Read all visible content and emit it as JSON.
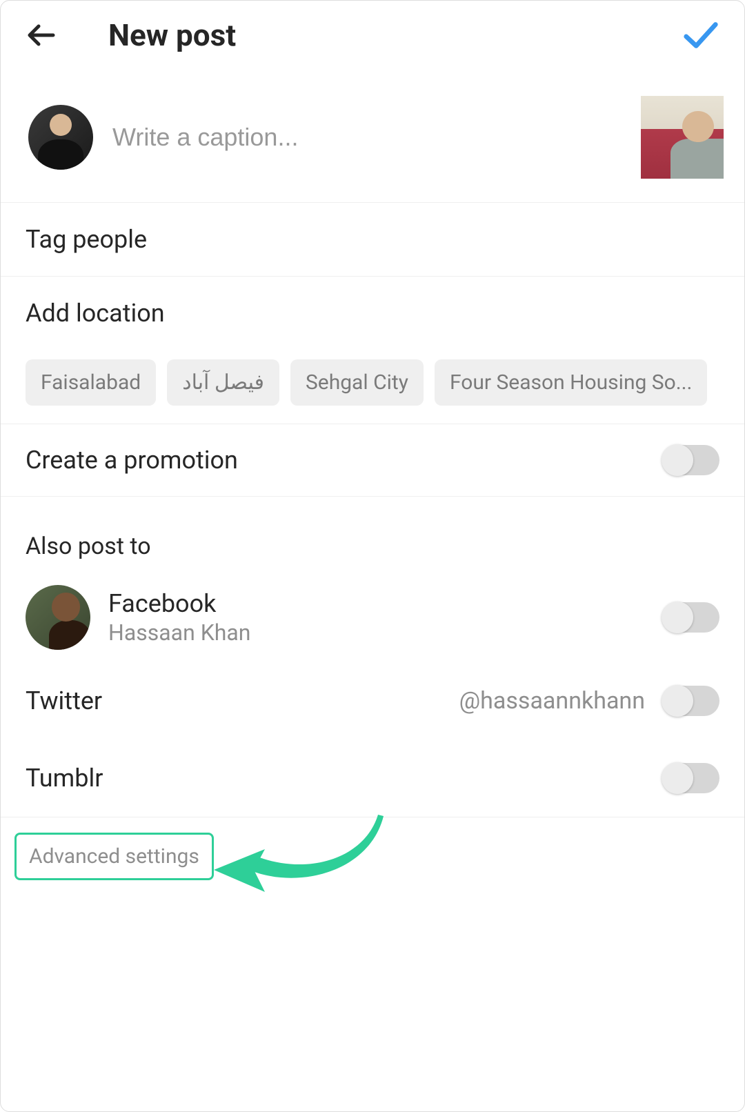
{
  "header": {
    "title": "New post"
  },
  "caption": {
    "placeholder": "Write a caption..."
  },
  "rows": {
    "tag_people": "Tag people",
    "add_location": "Add location",
    "create_promotion": "Create a promotion"
  },
  "location_suggestions": [
    "Faisalabad",
    "فیصل آباد",
    "Sehgal City",
    "Four Season Housing So..."
  ],
  "also_post": {
    "heading": "Also post to",
    "items": [
      {
        "name": "Facebook",
        "sub": "Hassaan Khan",
        "hasAvatar": true
      },
      {
        "name": "Twitter",
        "handle": "@hassaannkhann"
      },
      {
        "name": "Tumblr"
      }
    ]
  },
  "advanced": {
    "label": "Advanced settings"
  },
  "colors": {
    "accent_blue": "#3897f0",
    "annotation_green": "#2ecf98"
  }
}
